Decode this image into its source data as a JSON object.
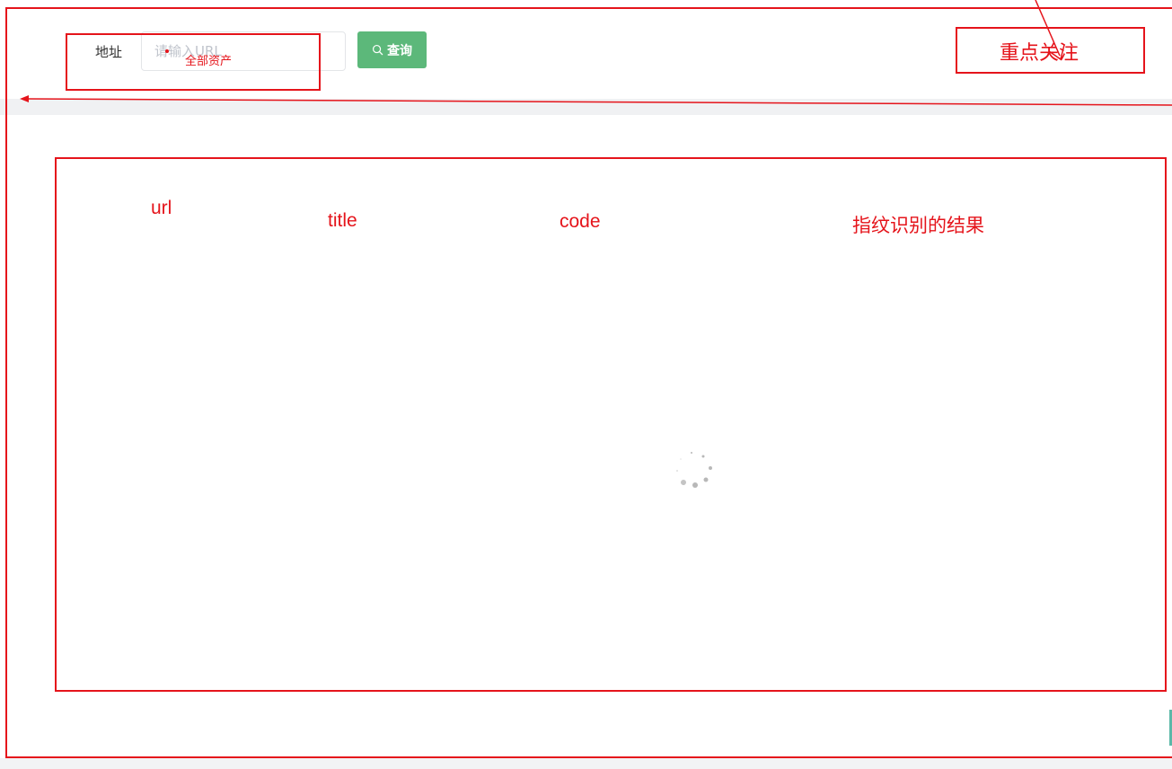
{
  "search": {
    "address_label": "地址",
    "url_placeholder": "请输入URL",
    "url_value": "",
    "query_button_label": "查询",
    "button_color": "#5cb87a"
  },
  "annotations": {
    "all_assets": "全部资产",
    "focus": "重点关注",
    "columns": [
      "url",
      "title",
      "code",
      "指纹识别的结果"
    ],
    "color": "#e5141b"
  },
  "icons": {
    "search": "search-icon",
    "loading": "loading-spinner-icon"
  }
}
